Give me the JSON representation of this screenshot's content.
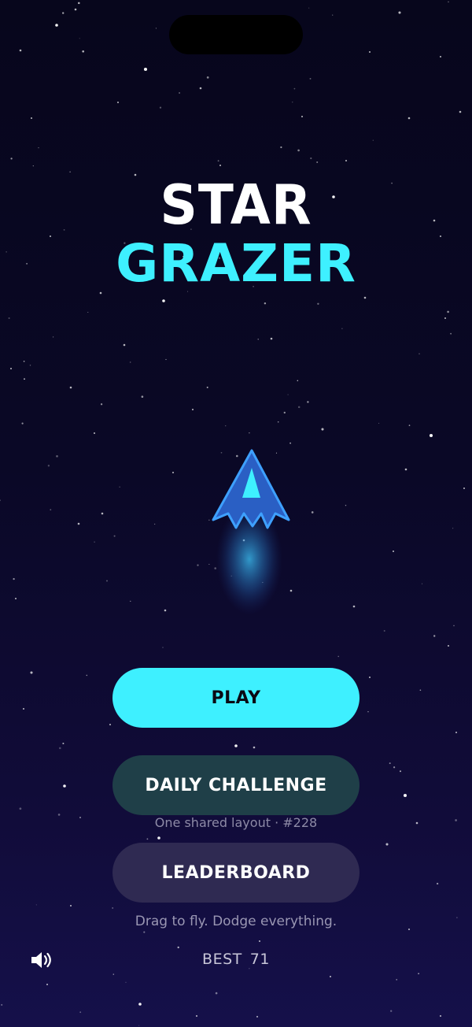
{
  "game": {
    "title_line1": "STAR",
    "title_line2": "GRAZER"
  },
  "menu": {
    "play_label": "PLAY",
    "daily_label": "DAILY CHALLENGE",
    "daily_caption": "One shared layout · #228",
    "leaderboard_label": "LEADERBOARD"
  },
  "hint": "Drag to fly. Dodge everything.",
  "best": {
    "label": "BEST",
    "value": "71"
  },
  "icons": {
    "sound": "speaker-on-icon",
    "ship": "spaceship-icon"
  },
  "colors": {
    "accent": "#3ef0ff",
    "background_top": "#07061c",
    "background_bottom": "#15104a",
    "daily_button": "#1f3f48",
    "leaderboard_button": "#2f2a52",
    "ship_body": "#2b6fd6",
    "ship_cockpit": "#3ef0ff"
  }
}
